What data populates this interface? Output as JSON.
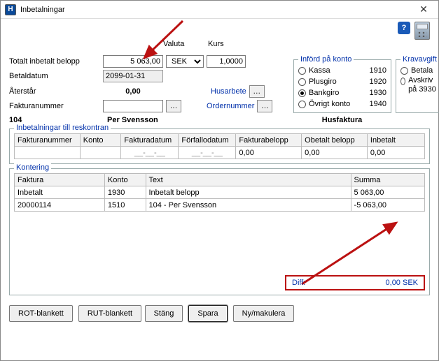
{
  "window": {
    "title": "Inbetalningar"
  },
  "labels": {
    "total": "Totalt inbetalt belopp",
    "betaldatum": "Betaldatum",
    "aterstar": "Återstår",
    "fakturanummer": "Fakturanummer",
    "valuta": "Valuta",
    "kurs": "Kurs",
    "husarbete": "Husarbete",
    "ordernummer": "Ordernummer"
  },
  "values": {
    "total": "5 063,00",
    "betaldatum": "2099-01-31",
    "aterstar": "0,00",
    "fakturanummer": "",
    "valuta": "SEK",
    "kurs": "1,0000"
  },
  "infoline": {
    "nr": "104",
    "name": "Per Svensson",
    "type": "Husfaktura"
  },
  "inford": {
    "legend": "Införd på konto",
    "options": [
      {
        "label": "Kassa",
        "num": "1910",
        "sel": false
      },
      {
        "label": "Plusgiro",
        "num": "1920",
        "sel": false
      },
      {
        "label": "Bankgiro",
        "num": "1930",
        "sel": true
      },
      {
        "label": "Övrigt konto",
        "num": "1940",
        "sel": false
      }
    ]
  },
  "krav": {
    "legend": "Kravavgift",
    "options": [
      {
        "label": "Betala",
        "sel": false
      },
      {
        "label": "Avskriv på 3930",
        "sel": false
      }
    ]
  },
  "reskontra": {
    "legend": "Inbetalningar till reskontran",
    "headers": {
      "fakt": "Fakturanummer",
      "konto": "Konto",
      "fdat": "Fakturadatum",
      "ffdat": "Förfallodatum",
      "fbel": "Fakturabelopp",
      "obe": "Obetalt belopp",
      "inb": "Inbetalt"
    },
    "row": {
      "fakt": "",
      "konto": "",
      "fdat": "__-__-__",
      "ffdat": "__-__-__",
      "fbel": "0,00",
      "obe": "0,00",
      "inb": "0,00"
    }
  },
  "kontering": {
    "legend": "Kontering",
    "headers": {
      "fakt": "Faktura",
      "konto": "Konto",
      "text": "Text",
      "summa": "Summa"
    },
    "rows": [
      {
        "fakt": "Inbetalt",
        "konto": "1930",
        "text": "Inbetalt belopp",
        "summa": "5 063,00"
      },
      {
        "fakt": "20000114",
        "konto": "1510",
        "text": "104 - Per Svensson",
        "summa": "-5 063,00"
      }
    ]
  },
  "diff": {
    "label": "Diff:",
    "value": "0,00 SEK"
  },
  "buttons": {
    "rot": "ROT-blankett",
    "rut": "RUT-blankett",
    "stang": "Stäng",
    "spara": "Spara",
    "ny": "Ny/makulera"
  }
}
